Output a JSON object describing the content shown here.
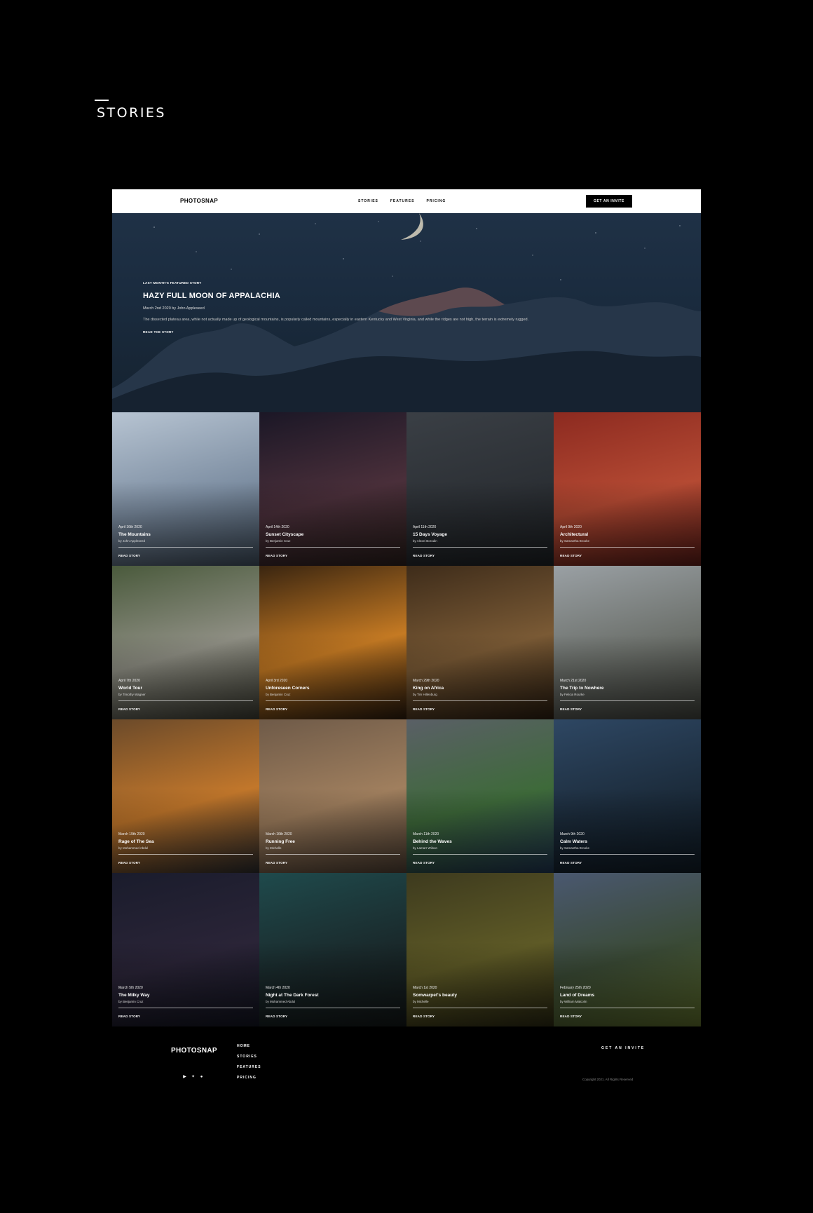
{
  "page": {
    "heading": "STORIES"
  },
  "header": {
    "logo": "PHOTOSNAP",
    "nav": [
      "STORIES",
      "FEATURES",
      "PRICING"
    ],
    "cta": "GET AN INVITE"
  },
  "hero": {
    "kicker": "LAST MONTH'S FEATURED STORY",
    "title": "HAZY FULL MOON OF APPALACHIA",
    "meta": "March 2nd 2020 by John Appleseed",
    "description": "The dissected plateau area, while not actually made up of geological mountains, is popularly called mountains, especially in eastern Kentucky and West Virginia, and while the ridges are not high, the terrain is extremely rugged.",
    "link": "READ THE STORY"
  },
  "stories": [
    {
      "date": "April 16th 2020",
      "title": "The Mountains",
      "author": "by John Appleseed",
      "link": "READ STORY",
      "colors": [
        "#b7c4d2",
        "#7d8ea2",
        "#3f4d5c"
      ]
    },
    {
      "date": "April 14th 2020",
      "title": "Sunset Cityscape",
      "author": "by Benjamin Cruz",
      "link": "READ STORY",
      "colors": [
        "#1b1726",
        "#4a2f3a",
        "#2b1f1c"
      ]
    },
    {
      "date": "April 11th 2020",
      "title": "15 Days Voyage",
      "author": "by Alexei Borodin",
      "link": "READ STORY",
      "colors": [
        "#3a3f45",
        "#2c3035",
        "#1d2023"
      ]
    },
    {
      "date": "April 9th 2020",
      "title": "Architectural",
      "author": "by Samantha Brooke",
      "link": "READ STORY",
      "colors": [
        "#8c2a20",
        "#b54a33",
        "#5a1c17"
      ]
    },
    {
      "date": "April 7th 2020",
      "title": "World Tour",
      "author": "by Timothy Wagner",
      "link": "READ STORY",
      "colors": [
        "#4a5a3c",
        "#8f8f84",
        "#3a3a30"
      ]
    },
    {
      "date": "April 3rd 2020",
      "title": "Unforeseen Corners",
      "author": "by Benjamin Cruz",
      "link": "READ STORY",
      "colors": [
        "#3a2510",
        "#c57a23",
        "#2a1a0c"
      ]
    },
    {
      "date": "March 29th 2020",
      "title": "King on Africa",
      "author": "by Tim Hillenburg",
      "link": "READ STORY",
      "colors": [
        "#3e2c1a",
        "#7a5a35",
        "#2a1d10"
      ]
    },
    {
      "date": "March 21st 2020",
      "title": "The Trip to Nowhere",
      "author": "by Felicia Rourke",
      "link": "READ STORY",
      "colors": [
        "#9aa0a4",
        "#6b6f6a",
        "#3e403a"
      ]
    },
    {
      "date": "March 19th 2020",
      "title": "Rage of The Sea",
      "author": "by Mohammed Abdul",
      "link": "READ STORY",
      "colors": [
        "#6b4a2a",
        "#c2772b",
        "#2a2a2c"
      ]
    },
    {
      "date": "March 16th 2020",
      "title": "Running Free",
      "author": "by Michelle",
      "link": "READ STORY",
      "colors": [
        "#6e5a48",
        "#a07f5e",
        "#4e3f33"
      ]
    },
    {
      "date": "March 11th 2020",
      "title": "Behind the Waves",
      "author": "by Lamarr Wilson",
      "link": "READ STORY",
      "colors": [
        "#5a5f66",
        "#3e6a3a",
        "#1f3450"
      ]
    },
    {
      "date": "March 9th 2020",
      "title": "Calm Waters",
      "author": "by Samantha Brooke",
      "link": "READ STORY",
      "colors": [
        "#2e4763",
        "#1c2c3c",
        "#0f1a24"
      ]
    },
    {
      "date": "March 5th 2020",
      "title": "The Milky Way",
      "author": "by Benjamin Cruz",
      "link": "READ STORY",
      "colors": [
        "#1a1c2c",
        "#2a2437",
        "#121420"
      ]
    },
    {
      "date": "March 4th 2020",
      "title": "Night at The Dark Forest",
      "author": "by Mohammed Abdul",
      "link": "READ STORY",
      "colors": [
        "#1f4a4c",
        "#1a2a2c",
        "#121616"
      ]
    },
    {
      "date": "March 1st 2020",
      "title": "Somwarpet's beauty",
      "author": "by Michelle",
      "link": "READ STORY",
      "colors": [
        "#3d3a1e",
        "#5e5a26",
        "#2a2812"
      ]
    },
    {
      "date": "February 25th 2020",
      "title": "Land of Dreams",
      "author": "by William Malcolm",
      "link": "READ STORY",
      "colors": [
        "#4a5870",
        "#3a4a35",
        "#5a6a2a"
      ]
    }
  ],
  "footer": {
    "logo": "PHOTOSNAP",
    "nav": [
      "HOME",
      "STORIES",
      "FEATURES",
      "PRICING"
    ],
    "cta": "GET AN INVITE",
    "copyright": "Copyright 2021. All Rights Reserved",
    "social_icons": [
      "youtube-icon",
      "twitter-icon",
      "pinterest-icon"
    ]
  }
}
